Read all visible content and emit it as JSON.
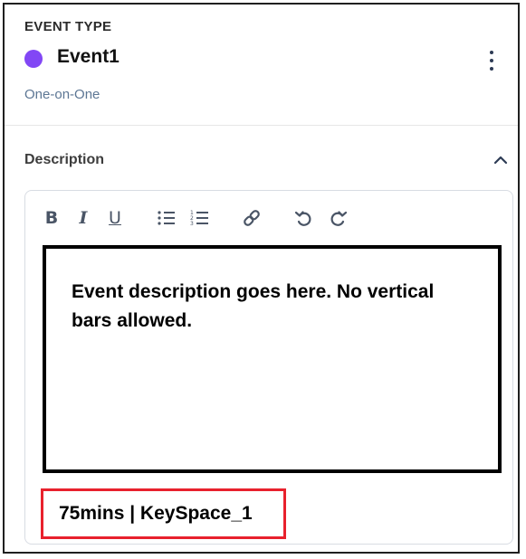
{
  "event": {
    "section_label": "EVENT TYPE",
    "name": "Event1",
    "color": "#8247f5",
    "subtype": "One-on-One",
    "menu_icon": "kebab-menu-icon"
  },
  "description": {
    "heading": "Description",
    "toggle_icon": "chevron-up-icon",
    "toolbar": [
      "bold-icon",
      "italic-icon",
      "underline-icon",
      "bulleted-list-icon",
      "numbered-list-icon",
      "link-icon",
      "undo-icon",
      "redo-icon"
    ],
    "text": "Event description goes here. No vertical bars allowed.",
    "footer_meta": "75mins | KeySpace_1"
  },
  "colors": {
    "highlight_border": "#e8212d",
    "subtype_text": "#5c7694"
  }
}
